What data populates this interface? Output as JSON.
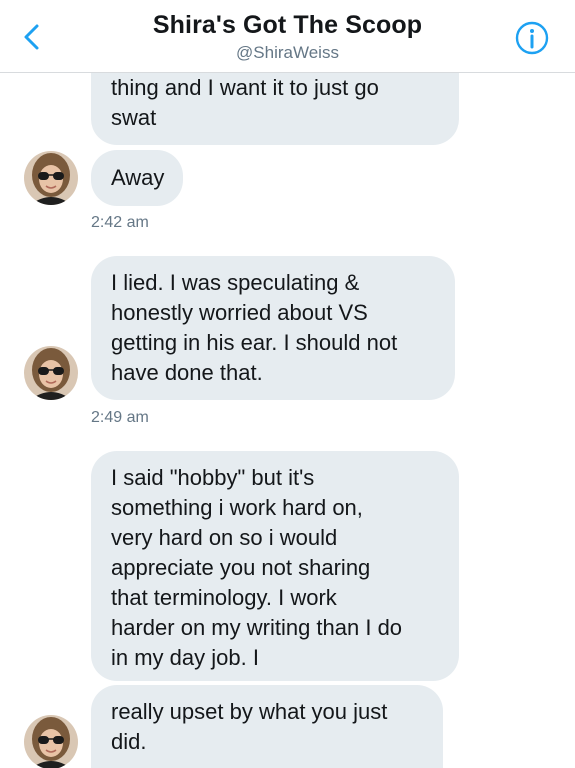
{
  "header": {
    "title": "Shira's Got The Scoop",
    "handle": "@ShiraWeiss",
    "back_icon": "chevron-left-icon",
    "info_icon": "info-circle-icon",
    "accent_color": "#1da1f2"
  },
  "messages": [
    {
      "text": "thing and I want it to just go\nswat"
    },
    {
      "text": "Away",
      "timestamp": "2:42 am"
    },
    {
      "text": "I lied. I was speculating &\nhonestly worried about VS\ngetting in his ear. I should not\nhave done that.",
      "timestamp": "2:49 am"
    },
    {
      "text": "I said \"hobby\" but it's\nsomething i work hard on,\nvery hard on so i would\nappreciate you not sharing\nthat terminology. I work\nharder on my writing than I do\nin my day job. I"
    },
    {
      "text": "really upset by what you just\ndid."
    }
  ]
}
